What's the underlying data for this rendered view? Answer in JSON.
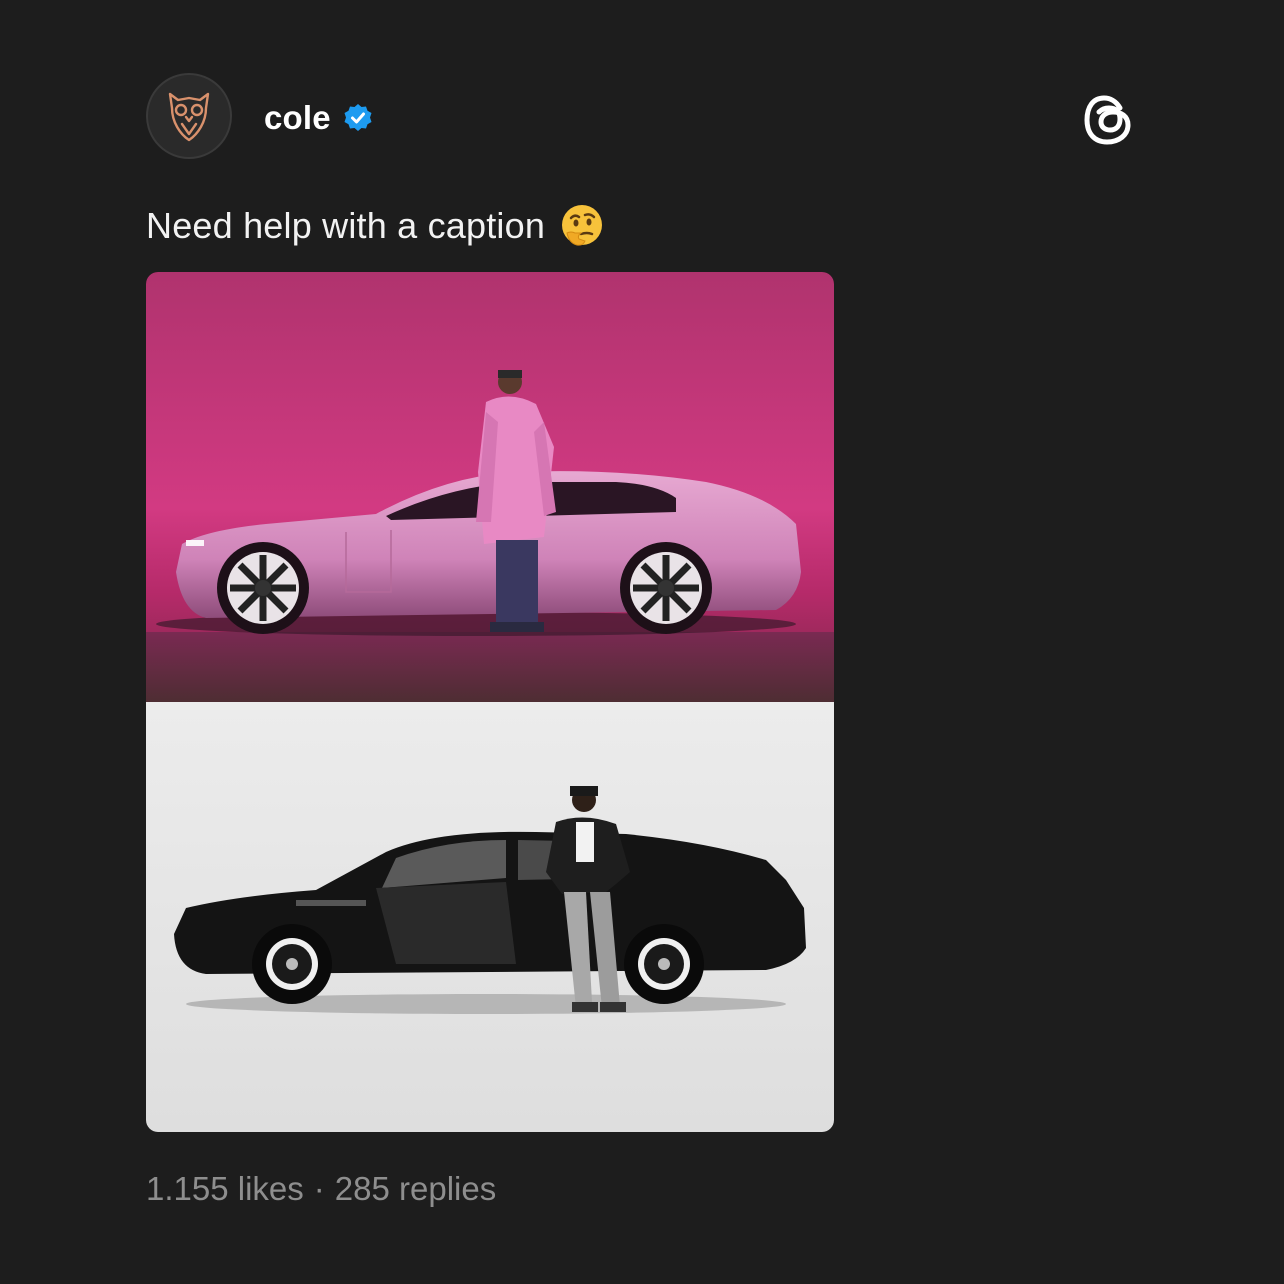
{
  "post": {
    "author": {
      "username": "cole",
      "verified": true,
      "avatar_icon": "owl-logo-icon",
      "verified_color": "#1d9bf0"
    },
    "app_icon": "threads-logo-icon",
    "caption": "Need help with a caption",
    "caption_emoji": "thinking-face-emoji",
    "media": [
      {
        "name": "photo-pink-car",
        "description_icon": "photo-icon"
      },
      {
        "name": "photo-black-car",
        "description_icon": "photo-icon"
      }
    ],
    "stats": {
      "likes": "1.155 likes",
      "separator": "·",
      "replies": "285 replies"
    }
  },
  "colors": {
    "background": "#1d1d1d",
    "text_primary": "#ffffff",
    "text_secondary": "#8e8e8e",
    "accent_pink": "#c2306f"
  }
}
